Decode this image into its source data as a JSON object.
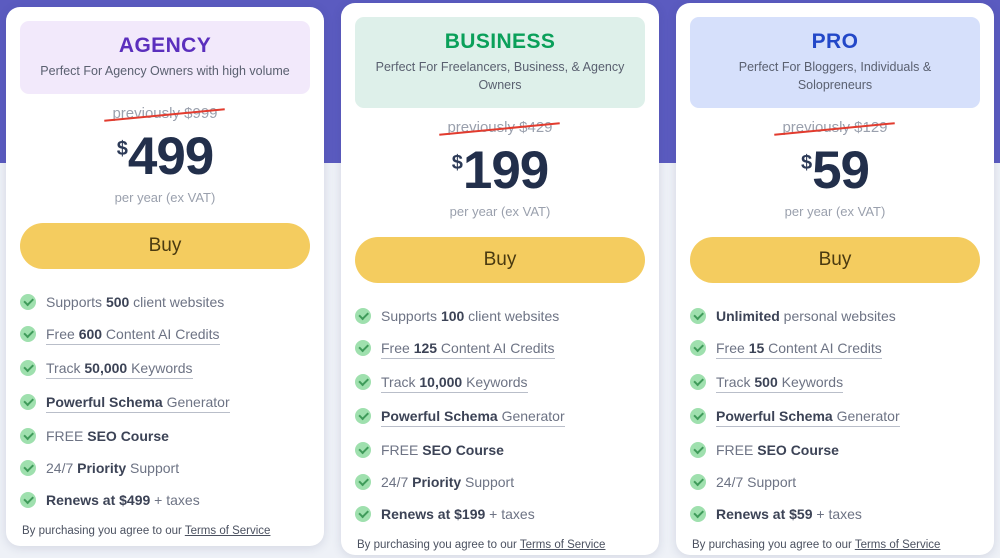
{
  "background": {
    "band_color": "#5b5bc0",
    "page_color": "#eef1f7"
  },
  "common": {
    "currency_symbol": "$",
    "price_period": "per year (ex VAT)",
    "buy_label": "Buy",
    "terms_prefix": "By purchasing you agree to our ",
    "terms_link": "Terms of Service",
    "check_icon": "check-circle-icon"
  },
  "plans": [
    {
      "id": "agency",
      "name": "AGENCY",
      "name_color": "#5b2fbd",
      "header_bg": "#f2e9fb",
      "tagline": "Perfect For Agency Owners with high volume",
      "previous_price": "previously $999",
      "price": "499",
      "features": [
        {
          "pre": "Supports ",
          "strong": "500",
          "post": " client websites",
          "underlined": false
        },
        {
          "pre": "Free ",
          "strong": "600",
          "post": " Content AI Credits",
          "underlined": true
        },
        {
          "pre": "Track ",
          "strong": "50,000",
          "post": " Keywords",
          "underlined": true
        },
        {
          "pre": "",
          "strong": "Powerful Schema",
          "post": " Generator",
          "underlined": true
        },
        {
          "pre": "FREE ",
          "strong": "SEO Course",
          "post": "",
          "underlined": false
        },
        {
          "pre": "24/7 ",
          "strong": "Priority",
          "post": " Support",
          "underlined": false
        },
        {
          "pre": "",
          "strong": "Renews at $499",
          "post": " + taxes",
          "underlined": false
        }
      ]
    },
    {
      "id": "business",
      "name": "BUSINESS",
      "name_color": "#0aa05a",
      "header_bg": "#def0ea",
      "tagline": "Perfect For Freelancers, Business, & Agency Owners",
      "previous_price": "previously $429",
      "price": "199",
      "features": [
        {
          "pre": "Supports ",
          "strong": "100",
          "post": " client websites",
          "underlined": false
        },
        {
          "pre": "Free ",
          "strong": "125",
          "post": " Content AI Credits",
          "underlined": true
        },
        {
          "pre": "Track ",
          "strong": "10,000",
          "post": " Keywords",
          "underlined": true
        },
        {
          "pre": "",
          "strong": "Powerful Schema",
          "post": " Generator",
          "underlined": true
        },
        {
          "pre": "FREE ",
          "strong": "SEO Course",
          "post": "",
          "underlined": false
        },
        {
          "pre": "24/7 ",
          "strong": "Priority",
          "post": " Support",
          "underlined": false
        },
        {
          "pre": "",
          "strong": "Renews at $199",
          "post": " + taxes",
          "underlined": false
        }
      ]
    },
    {
      "id": "pro",
      "name": "PRO",
      "name_color": "#2348c8",
      "header_bg": "#d6e0fb",
      "tagline": "Perfect For Bloggers, Individuals & Solopreneurs",
      "previous_price": "previously $129",
      "price": "59",
      "features": [
        {
          "pre": "",
          "strong": "Unlimited",
          "post": " personal websites",
          "underlined": false
        },
        {
          "pre": "Free ",
          "strong": "15",
          "post": " Content AI Credits",
          "underlined": true
        },
        {
          "pre": "Track ",
          "strong": "500",
          "post": " Keywords",
          "underlined": true
        },
        {
          "pre": "",
          "strong": "Powerful Schema",
          "post": " Generator",
          "underlined": true
        },
        {
          "pre": "FREE ",
          "strong": "SEO Course",
          "post": "",
          "underlined": false
        },
        {
          "pre": "24/7 Support",
          "strong": "",
          "post": "",
          "underlined": false
        },
        {
          "pre": "",
          "strong": "Renews at $59",
          "post": " + taxes",
          "underlined": false
        }
      ]
    }
  ]
}
